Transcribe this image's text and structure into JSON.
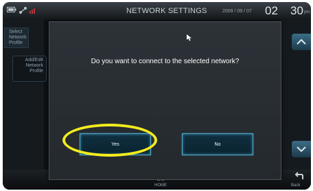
{
  "statusbar": {
    "title": "NETWORK SETTINGS",
    "date": "2009 / 09 / 07",
    "day": "02",
    "time": "30",
    "ampm": "pm",
    "icons": [
      "battery-icon",
      "network-icon",
      "signal-icon"
    ]
  },
  "sidebar": {
    "items": [
      {
        "label": "Select Network Profile"
      },
      {
        "label": "Add/Edit Network Profile"
      }
    ]
  },
  "dialog": {
    "message": "Do you want to connect to the selected network?",
    "yes_label": "Yes",
    "no_label": "No"
  },
  "bottombar": {
    "home_label": "HOME",
    "back_label": "Back"
  },
  "colors": {
    "highlight": "#f3ec1e",
    "button_border": "#4fa6c8",
    "dialog_bg": "#2a2f33",
    "device_bg": "#0e1114"
  }
}
